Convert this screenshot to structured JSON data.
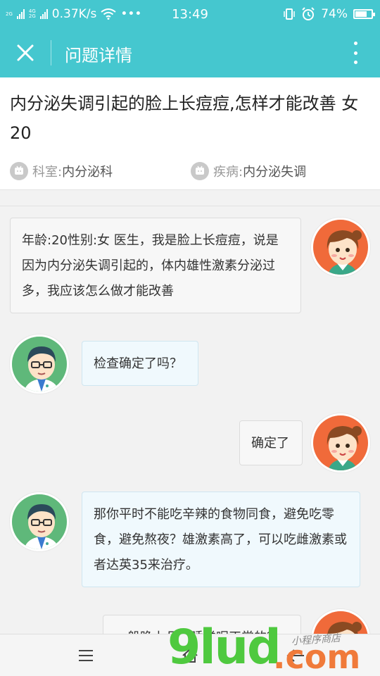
{
  "status_bar": {
    "signal_1": "2G",
    "signal_2": "4G",
    "signal_3": "2G",
    "net_speed": "0.37K/s",
    "more": "•••",
    "time": "13:49",
    "battery": "74%",
    "battery_level": 0.74
  },
  "app_bar": {
    "title": "问题详情"
  },
  "question": {
    "title": "内分泌失调引起的脸上长痘痘,怎样才能改善 女 20",
    "department_label": "科室:",
    "department": "内分泌科",
    "disease_label": "疾病:",
    "disease": "内分泌失调"
  },
  "messages": [
    {
      "role": "user",
      "text": "年龄:20性别:女 医生，我是脸上长痘痘，说是因为内分泌失调引起的，体内雄性激素分泌过多，我应该怎么做才能改善"
    },
    {
      "role": "doctor",
      "text": "检查确定了吗？"
    },
    {
      "role": "user",
      "text": "确定了"
    },
    {
      "role": "doctor",
      "text": "那你平时不能吃辛辣的食物同食，避免吃零食，避免熬夜？雄激素高了，可以吃雌激素或者达英35来治疗。"
    },
    {
      "role": "user",
      "text": "一般晚上几点睡觉呢正常的？"
    }
  ],
  "watermark": {
    "digits": "9lud",
    "domain": ".com",
    "tagline": "小程序商店"
  },
  "colors": {
    "header": "#45c7cf",
    "user_avatar_bg": "#f06a3a",
    "doctor_avatar_bg": "#5fb87a",
    "doctor_bubble": "#f0f9fd"
  }
}
